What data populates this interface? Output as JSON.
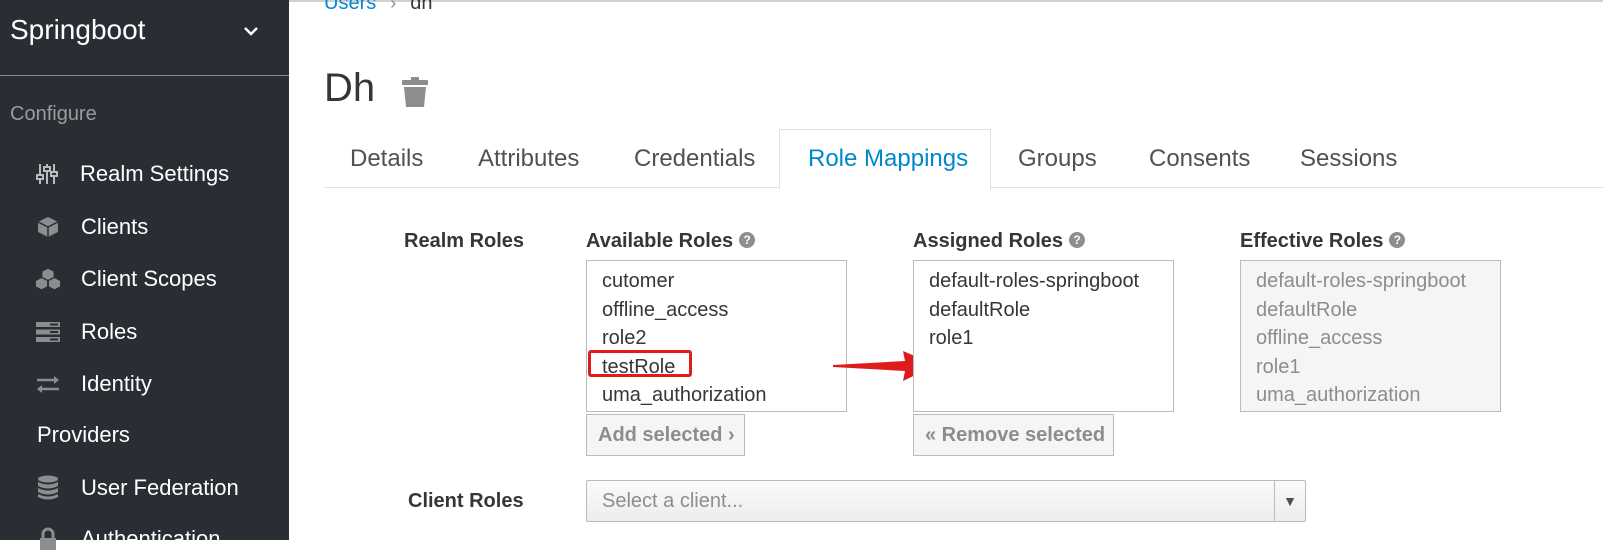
{
  "sidebar": {
    "realm": "Springboot",
    "section": "Configure",
    "items": [
      {
        "label": "Realm Settings",
        "icon": "sliders-icon"
      },
      {
        "label": "Clients",
        "icon": "cube-icon"
      },
      {
        "label": "Client Scopes",
        "icon": "cubes-icon"
      },
      {
        "label": "Roles",
        "icon": "list-icon"
      },
      {
        "label": "Identity",
        "icon": "exchange-icon"
      },
      {
        "label": "User Federation",
        "icon": "database-icon"
      },
      {
        "label": "Authentication",
        "icon": "lock-icon"
      }
    ],
    "identity_sub": "Providers"
  },
  "breadcrumb": {
    "parent": "Users",
    "separator": "›",
    "current": "dh"
  },
  "page": {
    "title": "Dh"
  },
  "tabs": [
    "Details",
    "Attributes",
    "Credentials",
    "Role Mappings",
    "Groups",
    "Consents",
    "Sessions"
  ],
  "active_tab": "Role Mappings",
  "realm_roles": {
    "label": "Realm Roles",
    "available": {
      "label": "Available Roles",
      "items": [
        "cutomer",
        "offline_access",
        "role2",
        "testRole",
        "uma_authorization"
      ],
      "button": "Add selected ›"
    },
    "assigned": {
      "label": "Assigned Roles",
      "items": [
        "default-roles-springboot",
        "defaultRole",
        "role1"
      ],
      "button": "« Remove selected"
    },
    "effective": {
      "label": "Effective Roles",
      "items": [
        "default-roles-springboot",
        "defaultRole",
        "offline_access",
        "role1",
        "uma_authorization"
      ]
    }
  },
  "client_roles": {
    "label": "Client Roles",
    "placeholder": "Select a client..."
  },
  "colors": {
    "sidebar": "#292e34",
    "accent": "#0088ce",
    "highlight": "#e01b1b"
  }
}
